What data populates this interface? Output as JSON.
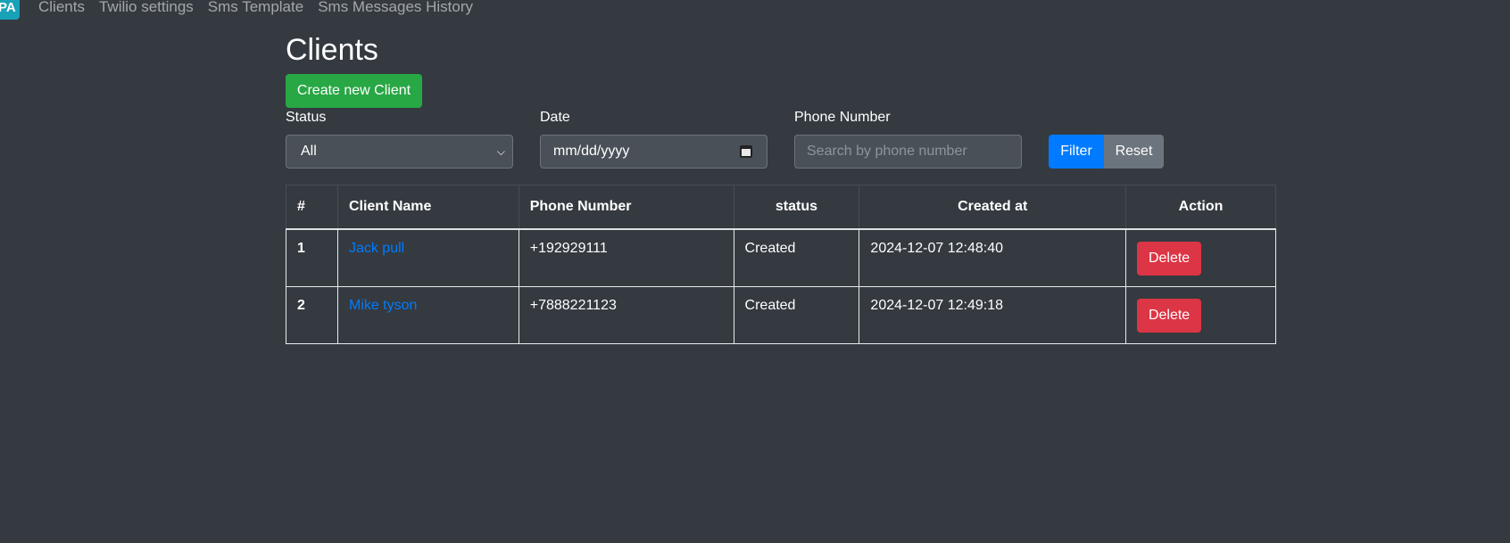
{
  "nav": {
    "brand": "PA",
    "links": [
      "Clients",
      "Twilio settings",
      "Sms Template",
      "Sms Messages History"
    ]
  },
  "page": {
    "title": "Clients",
    "create_button": "Create new Client"
  },
  "filters": {
    "status_label": "Status",
    "status_value": "All",
    "date_label": "Date",
    "date_value": "mm/dd/yyyy",
    "phone_label": "Phone Number",
    "phone_placeholder": "Search by phone number",
    "filter_button": "Filter",
    "reset_button": "Reset"
  },
  "table": {
    "headers": [
      "#",
      "Client Name",
      "Phone Number",
      "status",
      "Created at",
      "Action"
    ],
    "rows": [
      {
        "num": "1",
        "name": "Jack pull",
        "phone": "+192929111",
        "status": "Created",
        "created": "2024-12-07 12:48:40",
        "action": "Delete"
      },
      {
        "num": "2",
        "name": "Mike tyson",
        "phone": "+7888221123",
        "status": "Created",
        "created": "2024-12-07 12:49:18",
        "action": "Delete"
      }
    ]
  },
  "colors": {
    "background": "#343a40",
    "brand": "#17a2b8",
    "success": "#28a745",
    "primary": "#007bff",
    "secondary": "#6c757d",
    "danger": "#dc3545"
  }
}
